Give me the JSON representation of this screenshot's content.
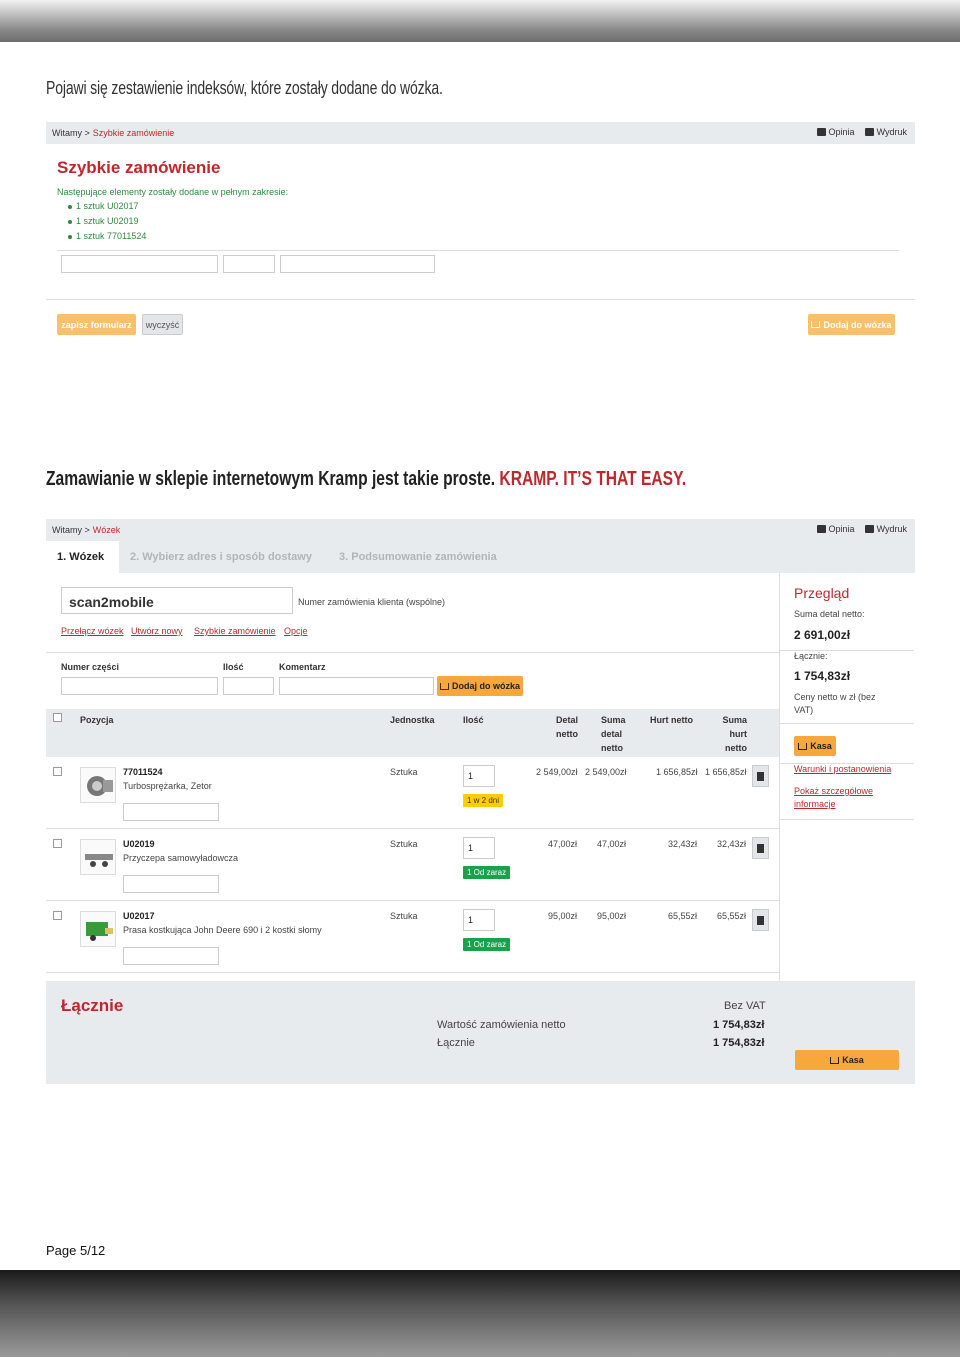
{
  "intro": "Pojawi się zestawienie indeksów, które zostały dodane do wózka.",
  "headline": {
    "text": "Zamawianie w sklepie internetowym Kramp jest takie proste.",
    "brand": "KRAMP. IT’S THAT EASY."
  },
  "page": "Page 5/12",
  "quick": {
    "crumb_home": "Witamy >",
    "crumb_current": "Szybkie zamówienie",
    "opinia": "Opinia",
    "wydruk": "Wydruk",
    "title": "Szybkie zamówienie",
    "note": "Następujące elementy zostały dodane w pełnym zakresie:",
    "items": [
      "1 sztuk U02017",
      "1 sztuk U02019",
      "1 sztuk 77011524"
    ],
    "save": "zapisz formularz",
    "clear": "wyczyść",
    "add": "Dodaj do wózka"
  },
  "cart": {
    "crumb_home": "Witamy >",
    "crumb_current": "Wózek",
    "opinia": "Opinia",
    "wydruk": "Wydruk",
    "tabs": [
      "1. Wózek",
      "2. Wybierz adres i sposób dostawy",
      "3. Podsumowanie zamówienia"
    ],
    "order_name": "scan2mobile",
    "order_label": "Numer zamówienia klienta  (wspólne)",
    "links": [
      "Przełącz wózek",
      "Utwórz nowy",
      "Szybkie zamówienie",
      "Opcje"
    ],
    "part_label": "Numer części",
    "qty_label": "Ilość",
    "comment_label": "Komentarz",
    "add": "Dodaj do wózka",
    "headers": {
      "pos": "Pozycja",
      "unit": "Jednostka",
      "qty": "Ilość",
      "detal1": "Detal",
      "detal2": "netto",
      "suma1": "Suma",
      "suma2": "detal",
      "suma3": "netto",
      "hurt": "Hurt netto",
      "sh1": "Suma",
      "sh2": "hurt",
      "sh3": "netto"
    },
    "rows": [
      {
        "code": "77011524",
        "name": "Turbosprężarka, Zetor",
        "unit": "Sztuka",
        "qty": "1",
        "badge": "1 w 2 dni",
        "badge_color": "#ffcc00",
        "detal": "2 549,00zł",
        "suma_detal": "2 549,00zł",
        "hurt": "1 656,85zł",
        "suma_hurt": "1 656,85zł"
      },
      {
        "code": "U02019",
        "name": "Przyczepa samowyładowcza",
        "unit": "Sztuka",
        "qty": "1",
        "badge": "1 Od zaraz",
        "badge_color": "#1aa24b",
        "detal": "47,00zł",
        "suma_detal": "47,00zł",
        "hurt": "32,43zł",
        "suma_hurt": "32,43zł"
      },
      {
        "code": "U02017",
        "name": "Prasa kostkująca John Deere 690 i 2 kostki słomy",
        "unit": "Sztuka",
        "qty": "1",
        "badge": "1 Od zaraz",
        "badge_color": "#1aa24b",
        "detal": "95,00zł",
        "suma_detal": "95,00zł",
        "hurt": "65,55zł",
        "suma_hurt": "65,55zł"
      }
    ],
    "overview": {
      "title": "Przegląd",
      "suma_label": "Suma detal netto:",
      "suma_value": "2 691,00zł",
      "total_label": "Łącznie:",
      "total_value": "1 754,83zł",
      "vat_note": "Ceny netto w zł (bez VAT)",
      "kasa": "Kasa",
      "terms": "Warunki i postanowienia",
      "details": "Pokaż szczegółowe informacje"
    },
    "totals": {
      "title": "Łącznie",
      "bez_vat": "Bez VAT",
      "wartosc_label": "Wartość zamówienia netto",
      "wartosc_value": "1 754,83zł",
      "lacznie_label": "Łącznie",
      "lacznie_value": "1 754,83zł",
      "kasa": "Kasa"
    }
  }
}
